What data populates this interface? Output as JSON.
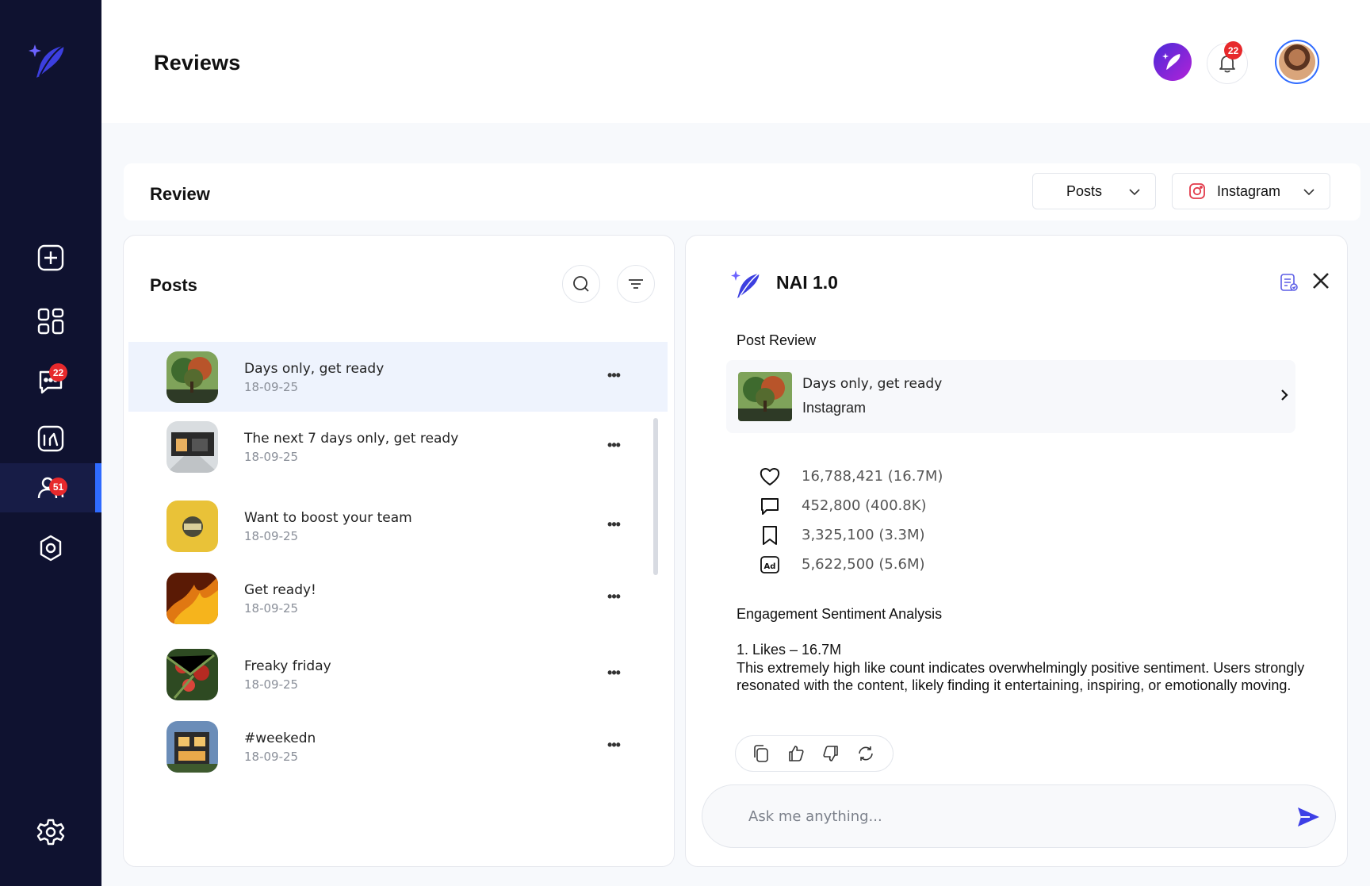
{
  "app": {
    "page_title": "Reviews",
    "notification_count": "22",
    "brand_color": "#2f6bff",
    "sidebar_bg": "#0f1230"
  },
  "sidebar": {
    "logo_icon": "feather-logo-icon",
    "items": [
      {
        "icon": "add-square-icon",
        "badge": null
      },
      {
        "icon": "grid-icon",
        "badge": null
      },
      {
        "icon": "messages-icon",
        "badge": "22"
      },
      {
        "icon": "analytics-icon",
        "badge": null
      },
      {
        "icon": "users-icon",
        "badge": "51",
        "active": true
      },
      {
        "icon": "settings-icon",
        "badge": null
      }
    ],
    "bottom_icon": "gear-icon"
  },
  "review_bar": {
    "title": "Review",
    "type_dropdown": "Posts",
    "platform_dropdown": "Instagram"
  },
  "posts_panel": {
    "title": "Posts",
    "posts": [
      {
        "title": "Days only, get ready",
        "date": "18-09-25",
        "selected": true
      },
      {
        "title": "The next 7 days only, get ready",
        "date": "18-09-25"
      },
      {
        "title": "Want to boost your team",
        "date": "18-09-25"
      },
      {
        "title": "Get ready!",
        "date": "18-09-25"
      },
      {
        "title": "Freaky friday",
        "date": "18-09-25"
      },
      {
        "title": "#weekedn",
        "date": "18-09-25"
      }
    ]
  },
  "nai_panel": {
    "title": "NAI 1.0",
    "post_review_label": "Post Review",
    "preview": {
      "title": "Days only, get ready",
      "platform": "Instagram"
    },
    "stats": [
      {
        "icon": "heart-icon",
        "value": "16,788,421 (16.7M)"
      },
      {
        "icon": "comment-icon",
        "value": "452,800 (400.8K)"
      },
      {
        "icon": "bookmark-icon",
        "value": "3,325,100 (3.3M)"
      },
      {
        "icon": "ad-icon",
        "value": "5,622,500 (5.6M)"
      }
    ],
    "analysis_title": "Engagement Sentiment Analysis",
    "analysis_heading": "1. Likes – 16.7M",
    "analysis_body": " This extremely high like count indicates overwhelmingly positive sentiment. Users strongly resonated with the content, likely finding it entertaining, inspiring, or emotionally moving.",
    "chat_placeholder": "Ask me anything..."
  }
}
